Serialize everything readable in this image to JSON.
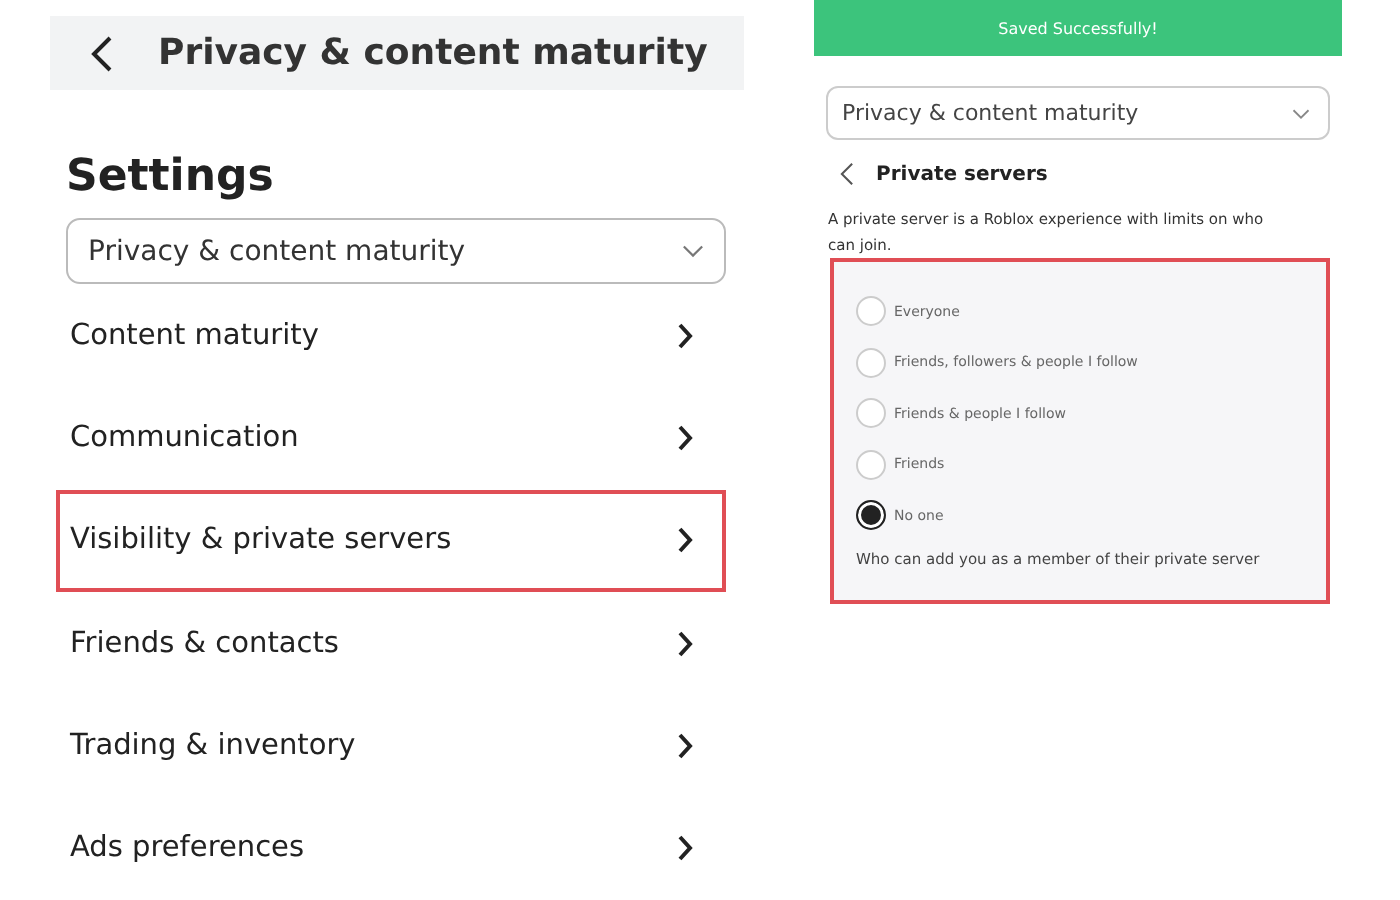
{
  "left": {
    "header": {
      "title": "Privacy & content maturity"
    },
    "heading": "Settings",
    "dropdown": {
      "value": "Privacy & content maturity"
    },
    "items": [
      {
        "label": "Content maturity",
        "highlighted": false
      },
      {
        "label": "Communication",
        "highlighted": false
      },
      {
        "label": "Visibility & private servers",
        "highlighted": true
      },
      {
        "label": "Friends & contacts",
        "highlighted": false
      },
      {
        "label": "Trading & inventory",
        "highlighted": false
      },
      {
        "label": "Ads preferences",
        "highlighted": false
      }
    ]
  },
  "right": {
    "toast": "Saved Successfully!",
    "dropdown": {
      "value": "Privacy & content maturity"
    },
    "section_title": "Private servers",
    "description": "A private server is a Roblox experience with limits on who can join.",
    "options_highlighted": true,
    "options": [
      {
        "label": "Everyone",
        "selected": false
      },
      {
        "label": "Friends, followers & people I follow",
        "selected": false
      },
      {
        "label": "Friends & people I follow",
        "selected": false
      },
      {
        "label": "Friends",
        "selected": false
      },
      {
        "label": "No one",
        "selected": true
      }
    ],
    "caption": "Who can add you as a member of their private server"
  }
}
